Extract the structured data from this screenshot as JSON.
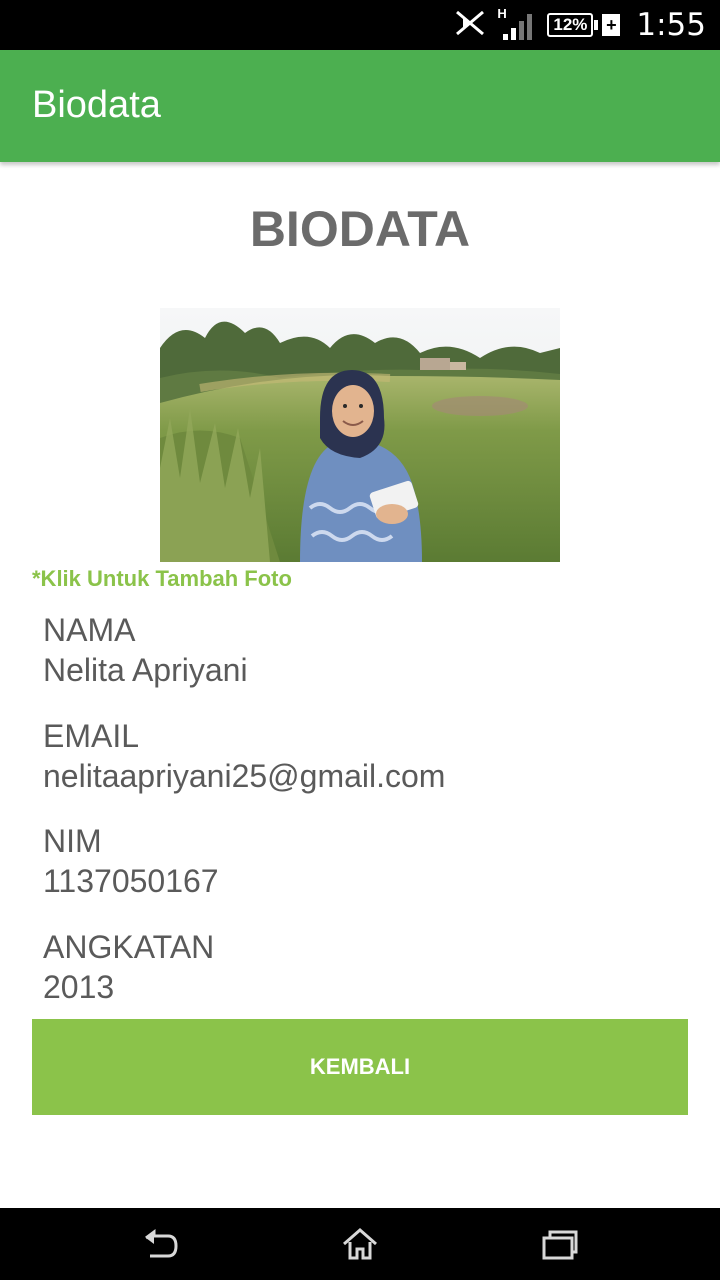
{
  "status_bar": {
    "time": "1:55",
    "battery_percent": "12%",
    "network_type": "H",
    "icons": [
      "no-nfc-icon",
      "signal-icon",
      "battery-icon",
      "charging-icon"
    ]
  },
  "app_bar": {
    "title": "Biodata",
    "color": "#4caf50"
  },
  "page": {
    "title": "BIODATA",
    "photo_hint": "*Klik Untuk Tambah Foto",
    "fields": [
      {
        "label": "NAMA",
        "value": "Nelita Apriyani"
      },
      {
        "label": "EMAIL",
        "value": "nelitaapriyani25@gmail.com"
      },
      {
        "label": "NIM",
        "value": "1137050167"
      },
      {
        "label": "ANGKATAN",
        "value": "2013"
      }
    ],
    "back_button": "KEMBALI",
    "accent": "#8bc34a"
  },
  "nav_bar": {
    "icons": [
      "back-icon",
      "home-icon",
      "recents-icon"
    ]
  }
}
